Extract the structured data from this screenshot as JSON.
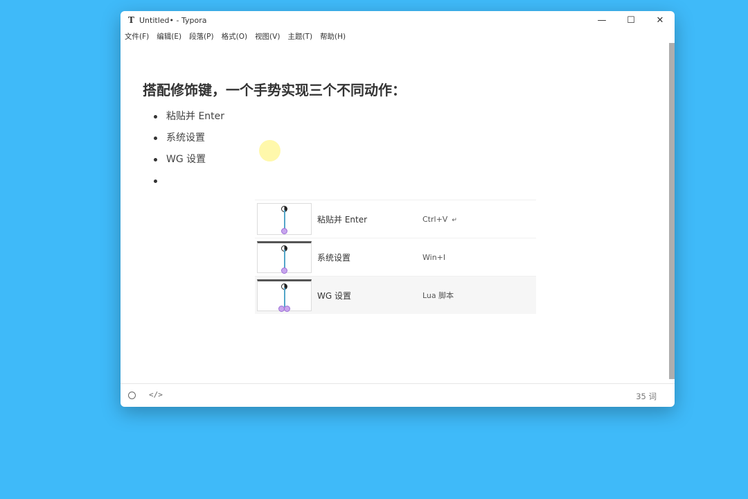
{
  "window": {
    "app_icon": "T",
    "title": "Untitled• - Typora",
    "controls": {
      "minimize": "—",
      "maximize": "☐",
      "close": "✕"
    }
  },
  "menu": [
    "文件(F)",
    "编辑(E)",
    "段落(P)",
    "格式(O)",
    "视图(V)",
    "主题(T)",
    "帮助(H)"
  ],
  "document": {
    "heading": "搭配修饰键，一个手势实现三个不同动作：",
    "bullets": [
      "粘贴并 Enter",
      "系统设置",
      "WG 设置",
      ""
    ]
  },
  "gesture_table": {
    "rows": [
      {
        "label": "粘贴并 Enter",
        "shortcut": "Ctrl+V",
        "return_mark": "↵"
      },
      {
        "label": "系统设置",
        "shortcut": "Win+I",
        "return_mark": ""
      },
      {
        "label": "WG 设置",
        "shortcut": "Lua 脚本",
        "return_mark": ""
      }
    ]
  },
  "status": {
    "word_count": "35 词",
    "source_icon": "</>"
  },
  "colors": {
    "background": "#3fbaf9",
    "gesture_line": "#53a6c9",
    "gesture_dot": "#c8a5ee"
  },
  "icons": {
    "status_left": "circle-icon",
    "status_source": "code-icon"
  }
}
